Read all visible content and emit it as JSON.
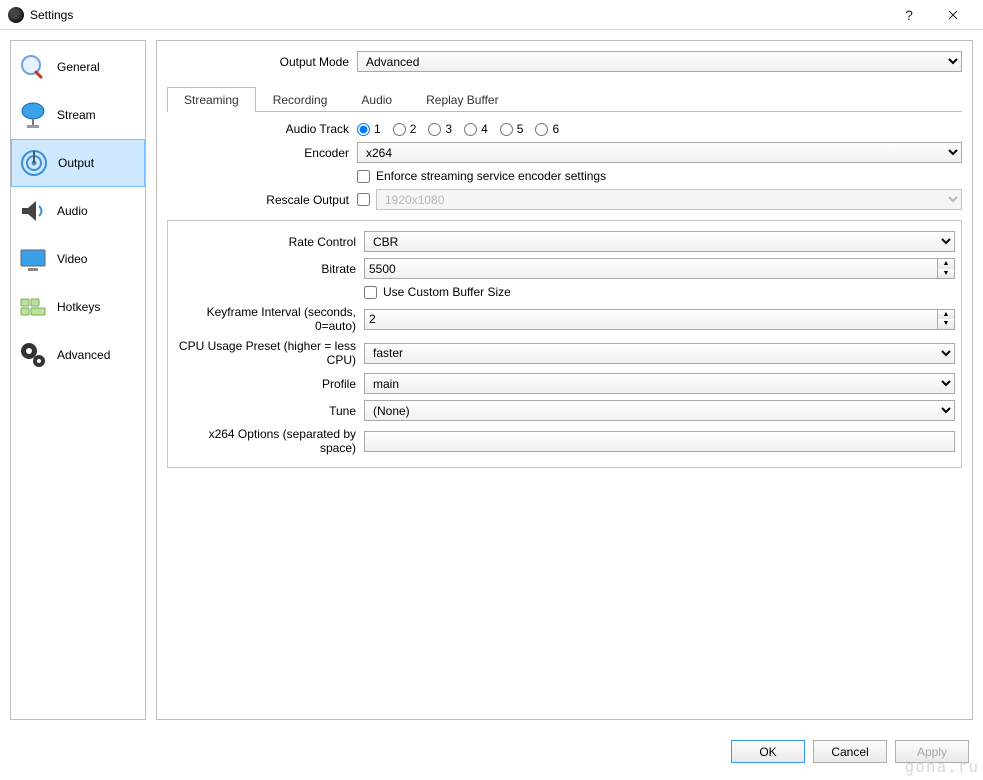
{
  "window": {
    "title": "Settings"
  },
  "sidebar": {
    "items": [
      {
        "label": "General",
        "icon": "general-icon"
      },
      {
        "label": "Stream",
        "icon": "stream-icon"
      },
      {
        "label": "Output",
        "icon": "output-icon",
        "selected": true
      },
      {
        "label": "Audio",
        "icon": "audio-icon"
      },
      {
        "label": "Video",
        "icon": "video-icon"
      },
      {
        "label": "Hotkeys",
        "icon": "hotkeys-icon"
      },
      {
        "label": "Advanced",
        "icon": "advanced-icon"
      }
    ]
  },
  "output_mode": {
    "label": "Output Mode",
    "value": "Advanced"
  },
  "tabs": [
    {
      "label": "Streaming",
      "active": true
    },
    {
      "label": "Recording"
    },
    {
      "label": "Audio"
    },
    {
      "label": "Replay Buffer"
    }
  ],
  "streaming": {
    "audio_track_label": "Audio Track",
    "audio_tracks": [
      "1",
      "2",
      "3",
      "4",
      "5",
      "6"
    ],
    "audio_track_selected": "1",
    "encoder_label": "Encoder",
    "encoder_value": "x264",
    "enforce_label": "Enforce streaming service encoder settings",
    "rescale_label": "Rescale Output",
    "rescale_value": "1920x1080",
    "rate_control_label": "Rate Control",
    "rate_control_value": "CBR",
    "bitrate_label": "Bitrate",
    "bitrate_value": "5500",
    "custom_buffer_label": "Use Custom Buffer Size",
    "keyframe_label": "Keyframe Interval (seconds, 0=auto)",
    "keyframe_value": "2",
    "cpu_preset_label": "CPU Usage Preset (higher = less CPU)",
    "cpu_preset_value": "faster",
    "profile_label": "Profile",
    "profile_value": "main",
    "tune_label": "Tune",
    "tune_value": "(None)",
    "x264_opts_label": "x264 Options (separated by space)",
    "x264_opts_value": ""
  },
  "footer": {
    "ok": "OK",
    "cancel": "Cancel",
    "apply": "Apply"
  },
  "watermark": "goha.ru"
}
